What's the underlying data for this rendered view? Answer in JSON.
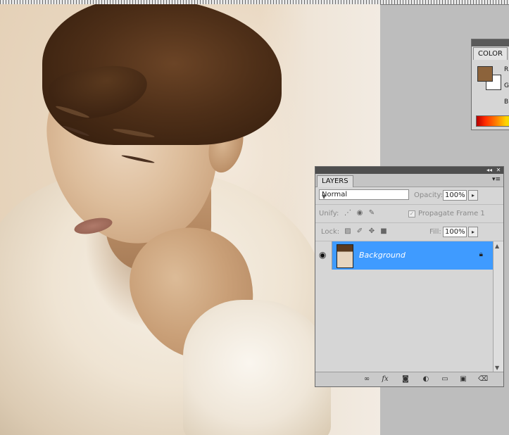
{
  "color_panel": {
    "tab": "COLOR",
    "channels": [
      "R",
      "G",
      "B"
    ],
    "foreground": "#8c633b",
    "background": "#ffffff"
  },
  "layers_panel": {
    "tab": "LAYERS",
    "collapse_icon": "◂◂",
    "close_icon": "✕",
    "menu_icon": "▾≡",
    "blend_mode": "Normal",
    "opacity_label": "Opacity:",
    "opacity_value": "100%",
    "unify_label": "Unify:",
    "propagate_label": "Propagate Frame 1",
    "lock_label": "Lock:",
    "fill_label": "Fill:",
    "fill_value": "100%",
    "layers": [
      {
        "name": "Background",
        "locked": true,
        "visible": true,
        "selected": true
      }
    ],
    "bottom_icons": [
      "link-icon",
      "fx-icon",
      "mask-icon",
      "adjustment-icon",
      "group-folder-icon",
      "new-layer-icon",
      "trash-icon"
    ],
    "fx_label": "fx"
  },
  "colors": {
    "selection_blue": "#3f9bff",
    "panel_gray": "#d6d6d6",
    "workspace_gray": "#bdbdbd"
  }
}
